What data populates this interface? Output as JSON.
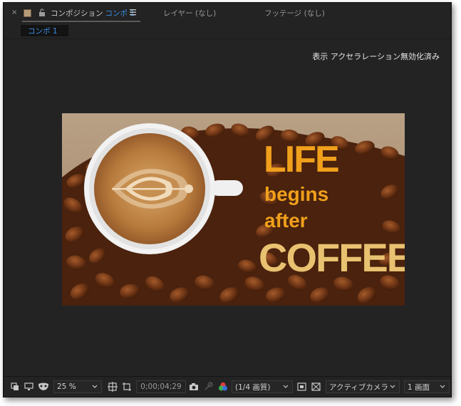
{
  "tabs": {
    "composition": {
      "prefix": "コンポジション",
      "name": "コンポ 1"
    },
    "layer": {
      "label": "レイヤー (なし)"
    },
    "footage": {
      "label": "フッテージ (なし)"
    }
  },
  "subtab": {
    "label": "コンポ 1"
  },
  "viewer": {
    "accel_note": "表示 アクセラレーション無効化済み",
    "image": {
      "line1": "LIFE",
      "line2": "begins",
      "line3": "after",
      "line4": "COFFEE",
      "text_color_orange": "#f0a01c",
      "text_color_gold": "#e8c270",
      "background": "#b59a7e"
    }
  },
  "toolbar": {
    "zoom": "25 %",
    "timecode": "0;00;04;29",
    "resolution": "(1/4 画質)",
    "camera": "アクティブカメラ",
    "views": "1 画面"
  },
  "colors": {
    "panel_bg": "#232323",
    "accent_blue": "#3a8ee6",
    "tab_text": "#9a9a9a"
  },
  "icons": [
    "close-icon",
    "color-swatch-icon",
    "lock-icon",
    "panel-menu-icon",
    "display-options-icon",
    "monitor-icon",
    "mask-icon",
    "grid-icon",
    "region-icon",
    "camera-icon",
    "transparency-icon",
    "color-channel-icon",
    "fast-preview-icon",
    "toggle-transparency-grid-icon"
  ]
}
